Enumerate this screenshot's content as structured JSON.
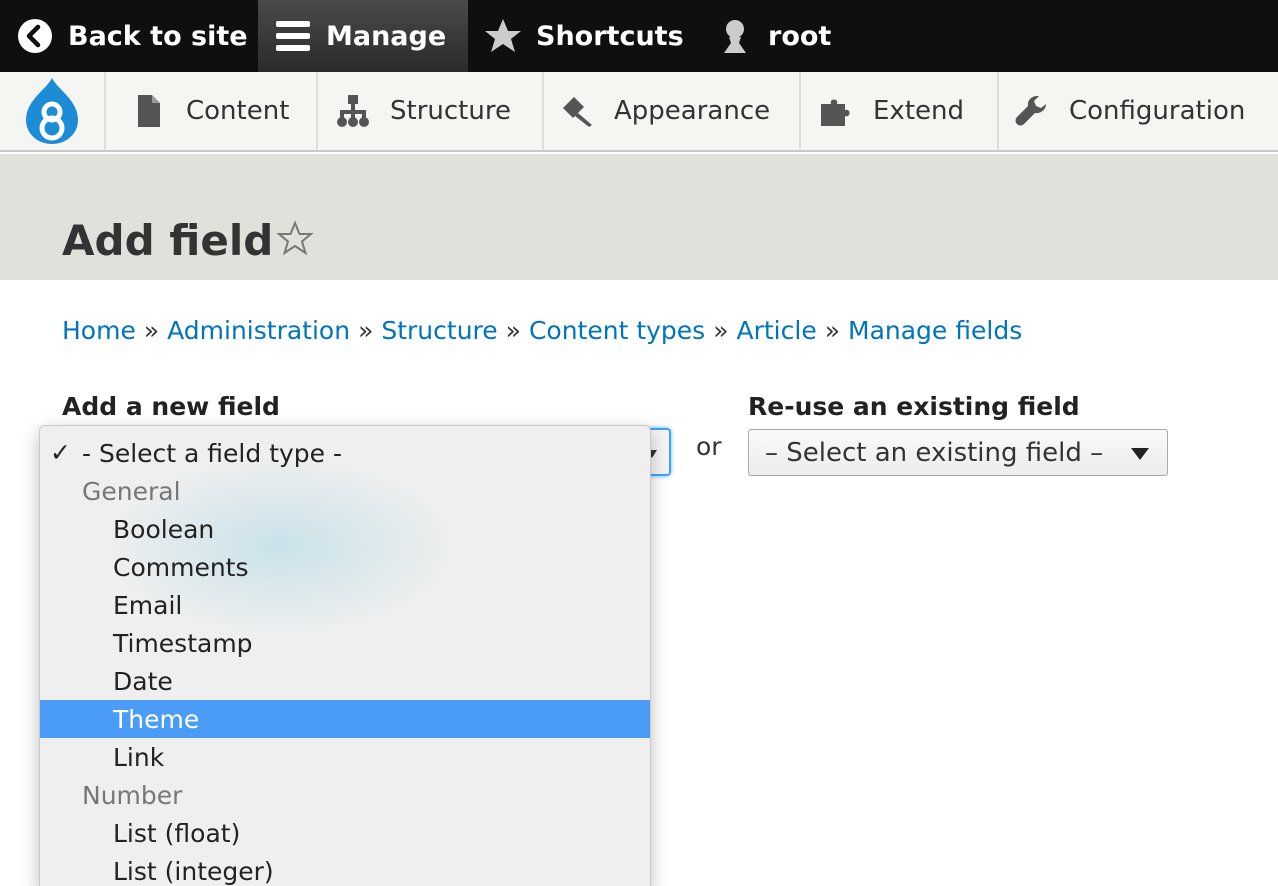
{
  "toolbar": {
    "back_label": "Back to site",
    "manage_label": "Manage",
    "shortcuts_label": "Shortcuts",
    "user_label": "root"
  },
  "tray": {
    "items": [
      {
        "label": "Content",
        "icon": "document-icon"
      },
      {
        "label": "Structure",
        "icon": "sitemap-icon"
      },
      {
        "label": "Appearance",
        "icon": "paintbrush-icon"
      },
      {
        "label": "Extend",
        "icon": "puzzle-icon"
      },
      {
        "label": "Configuration",
        "icon": "wrench-icon"
      }
    ]
  },
  "page": {
    "title": "Add field"
  },
  "breadcrumb": [
    "Home",
    "Administration",
    "Structure",
    "Content types",
    "Article",
    "Manage fields"
  ],
  "form": {
    "new_field_label": "Add a new field",
    "or_text": "or",
    "reuse_label": "Re-use an existing field",
    "existing_select_value": "– Select an existing field –"
  },
  "dropdown": {
    "check": "✓",
    "options": [
      {
        "text": "- Select a field type -",
        "kind": "first"
      },
      {
        "text": "General",
        "kind": "group"
      },
      {
        "text": "Boolean",
        "kind": "item"
      },
      {
        "text": "Comments",
        "kind": "item"
      },
      {
        "text": "Email",
        "kind": "item"
      },
      {
        "text": "Timestamp",
        "kind": "item"
      },
      {
        "text": "Date",
        "kind": "item"
      },
      {
        "text": "Theme",
        "kind": "item",
        "highlighted": true
      },
      {
        "text": "Link",
        "kind": "item"
      },
      {
        "text": "Number",
        "kind": "group"
      },
      {
        "text": "List (float)",
        "kind": "item"
      },
      {
        "text": "List (integer)",
        "kind": "item"
      }
    ]
  },
  "colors": {
    "link": "#0074bd",
    "highlight": "#4a9cf6",
    "toolbar_bg": "#0f0f0f"
  }
}
